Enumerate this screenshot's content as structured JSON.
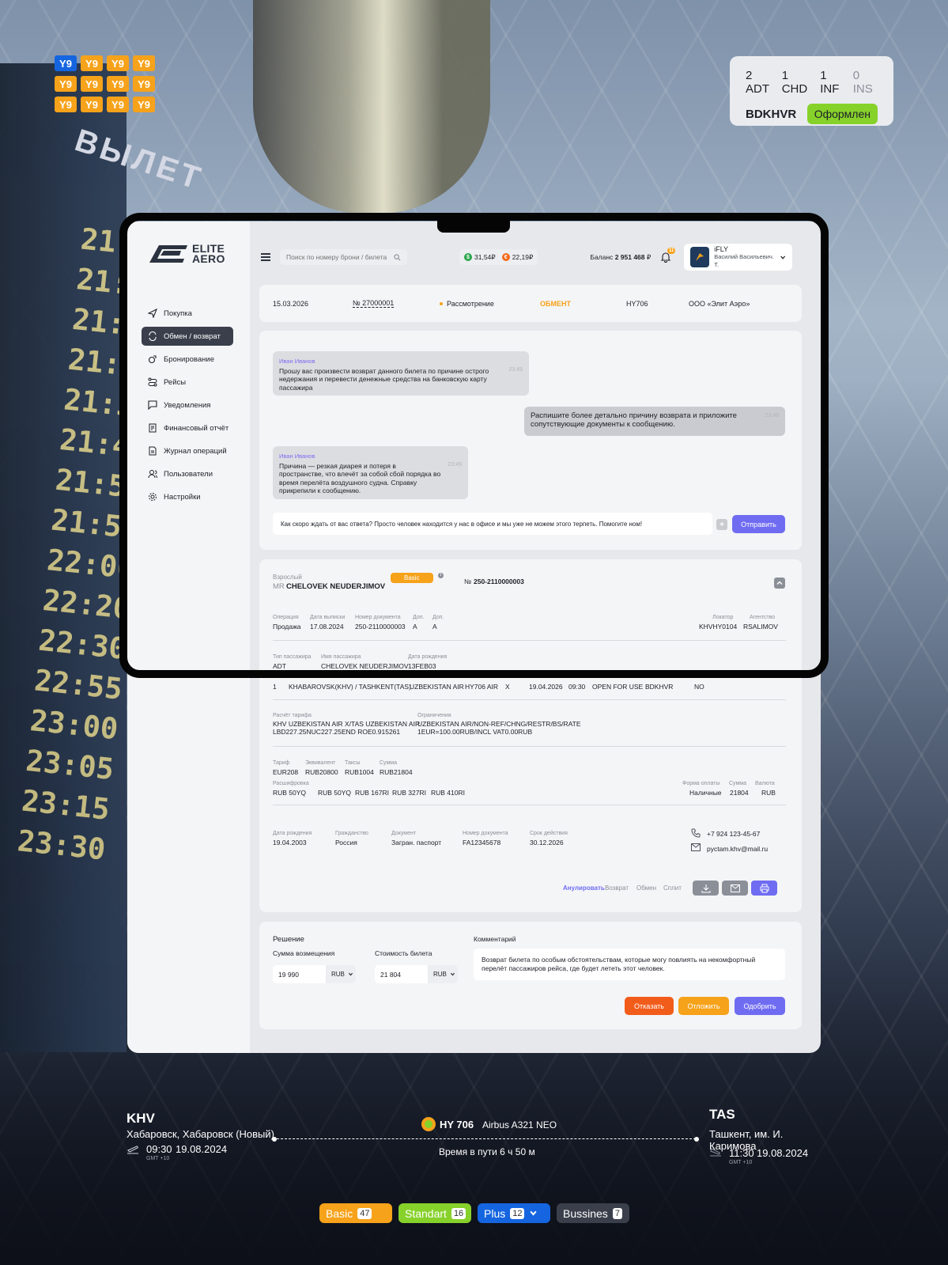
{
  "background": {
    "board_word": "ВЫЛЕТ",
    "board_times": [
      "21:05",
      "21:15",
      "21:20",
      "21:30",
      "21:30",
      "21:40",
      "21:50",
      "21:50",
      "22:00",
      "22:20",
      "22:30",
      "22:55",
      "23:00",
      "23:05",
      "23:15",
      "23:30"
    ]
  },
  "seat_classes": [
    "Y9",
    "Y9",
    "Y9",
    "Y9",
    "Y9",
    "Y9",
    "Y9",
    "Y9",
    "Y9",
    "Y9",
    "Y9",
    "Y9"
  ],
  "pax_summary": {
    "adt": "2 ADT",
    "chd": "1 CHD",
    "inf": "1 INF",
    "ins": "0 INS",
    "pnr": "BDKHVR",
    "status": "Оформлен"
  },
  "logo": {
    "line1": "ELITE",
    "line2": "AERO"
  },
  "sidebar": {
    "items": [
      {
        "label": "Покупка",
        "icon": "plane-icon"
      },
      {
        "label": "Обмен / возврат",
        "icon": "exchange-icon"
      },
      {
        "label": "Бронирование",
        "icon": "booking-icon"
      },
      {
        "label": "Рейсы",
        "icon": "route-icon"
      },
      {
        "label": "Уведомления",
        "icon": "chat-icon"
      },
      {
        "label": "Финансовый отчёт",
        "icon": "report-icon"
      },
      {
        "label": "Журнал операций",
        "icon": "journal-icon"
      },
      {
        "label": "Пользователи",
        "icon": "users-icon"
      },
      {
        "label": "Настройки",
        "icon": "gear-icon"
      }
    ]
  },
  "topbar": {
    "search_placeholder": "Поиск по номеру брони / билета",
    "wallet1": "31,54₽",
    "wallet2": "22,19₽",
    "balance_label": "Баланс",
    "balance_value": "2 951 468",
    "balance_currency": "₽",
    "notifications": "11",
    "user_company": "iFLY",
    "user_name": "Василий Васильевич. Т."
  },
  "request": {
    "date": "15.03.2026",
    "number_label": "№",
    "number": "27000001",
    "status": "Рассмотрение",
    "type": "ОБМЕНТ",
    "flight": "HY706",
    "agency": "ООО «Элит Аэро»"
  },
  "chat": {
    "messages": [
      {
        "author": "Иван Иванов",
        "text": "Прошу вас произвести возврат данного билета по причине острого недержания и перевести денежные средства на банковскую карту пассажира",
        "time": "23:49"
      },
      {
        "author": "",
        "text": "Распишите более детально причину возврата и приложите сопутствующие документы к сообщению.",
        "time": "23:49"
      },
      {
        "author": "Иван Иванов",
        "text": "Причина — резкая диарея и потеря в пространстве, что влечёт за собой сбой порядка во время перелёта воздушного судна. Справку прикрепили к сообщению.",
        "time": "23:49"
      }
    ],
    "input_value": "Как скоро ждать от вас ответа? Просто человек находится у нас в офисе и мы уже не можем этого терпеть. Помогите ном!",
    "send_label": "Отправить"
  },
  "ticket": {
    "pax_type": "Взрослый",
    "title": "MR",
    "name": "CHELOVEK NEUDERJIMOV",
    "fare_badge": "Basic",
    "ticket_no_label": "№",
    "ticket_no": "250-2110000003",
    "row1": {
      "labels": [
        "Операция",
        "Дата выписки",
        "Номер документа",
        "Доп.",
        "Доп."
      ],
      "values": [
        "Продажа",
        "17.08.2024",
        "250-2110000003",
        "A",
        "A"
      ],
      "pnr_label": "Локатор",
      "pnr": "KHVHY0104",
      "agency_label": "Агентство",
      "agency": "RSALIMOV"
    },
    "row2": {
      "labels": [
        "Тип пассажира",
        "Имя пассажира",
        "Дата рождения"
      ],
      "values": [
        "ADT",
        "CHELOVEK NEUDERJIMOV",
        "13FEB03"
      ]
    },
    "segment": [
      "1",
      "KHABAROVSK(KHV) / TASHKENT(TAS)",
      "UZBEKISTAN AIR",
      "HY706 AIR",
      "X",
      "19.04.2026",
      "09:30",
      "OPEN FOR USE",
      "BDKHVR",
      "NO"
    ],
    "calc_label": "Расчёт тарифа",
    "calc_1": "KHV UZBEKISTAN AIR X/TAS UZBEKISTAN AIR",
    "calc_2": "LBD227.25NUC227.25END ROE0.915261",
    "restr_label": "Ограничения",
    "restr_1": "UZBEKISTAN AIR/NON-REF/CHNG/RESTR/BS/RATE",
    "restr_2": "1EUR=100.00RUB/INCL VAT0.00RUB",
    "fare": {
      "labels": [
        "Тариф",
        "Эквивалент",
        "Таксы",
        "Сумма"
      ],
      "values": [
        "EUR208",
        "RUB20800",
        "RUB1004",
        "RUB21804"
      ]
    },
    "taxes_label": "Расшифровка",
    "taxes": [
      "RUB 50YQ",
      "RUB 50YQ",
      "RUB 167RI",
      "RUB 327RI",
      "RUB 410RI"
    ],
    "payment": {
      "labels": [
        "Форма оплаты",
        "Сумма",
        "Валюта"
      ],
      "values": [
        "Наличные",
        "21804",
        "RUB"
      ]
    },
    "passenger": {
      "labels": [
        "Дата рождения",
        "Гражданство",
        "Документ",
        "Номер документа",
        "Срок действия"
      ],
      "values": [
        "19.04.2003",
        "Россия",
        "Загран. паспорт",
        "FA12345678",
        "30.12.2026"
      ]
    },
    "phone": "+7 924 123-45-67",
    "email": "pyctam.khv@mail.ru",
    "actions": [
      "Анулировать",
      "Возврат",
      "Обмен",
      "Сплит"
    ]
  },
  "decision": {
    "title": "Решение",
    "refund_label": "Сумма возмещения",
    "refund_value": "19 990",
    "refund_currency": "RUB",
    "price_label": "Стоимость билета",
    "price_value": "21 804",
    "price_currency": "RUB",
    "comment_label": "Комментарий",
    "comment_value": "Возврат билета по особым обстоятельствам, которые могу повлиять на некомфортный перелёт пассажиров рейса, где будет лететь этот человек.",
    "reject": "Отказать",
    "postpone": "Отложить",
    "approve": "Одобрить"
  },
  "flight": {
    "from_code": "KHV",
    "from_city": "Хабаровск, Хабаровск (Новый)",
    "dep_time": "09:30",
    "dep_date": "19.08.2024",
    "dep_tz": "GMT +10",
    "flight_no": "HY 706",
    "aircraft": "Airbus A321 NEO",
    "duration": "Время в пути 6 ч 50 м",
    "to_code": "TAS",
    "to_city": "Ташкент, им. И. Каримова",
    "arr_time": "11:30",
    "arr_date": "19.08.2024",
    "arr_tz": "GMT +10"
  },
  "tariffs": [
    {
      "name": "Basic",
      "count": "47",
      "color": "#f6a21a"
    },
    {
      "name": "Standart",
      "count": "16",
      "color": "#87d12b"
    },
    {
      "name": "Plus",
      "count": "12",
      "color": "#1565e0"
    },
    {
      "name": "Bussines",
      "count": "7",
      "color": "#3a3f4b"
    }
  ]
}
